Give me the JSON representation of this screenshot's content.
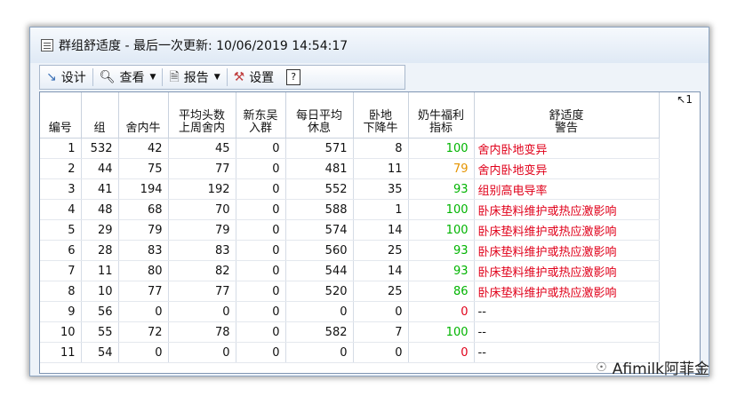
{
  "window": {
    "title": "群组舒适度 - 最后一次更新: 10/06/2019 14:54:17"
  },
  "toolbar": {
    "design": "设计",
    "view": "查看",
    "report": "报告",
    "settings": "设置",
    "help": "?"
  },
  "sort_mark": "↖1",
  "columns": [
    "编号",
    "组",
    "舍内牛",
    "平均头数\n上周舍内",
    "新东吴\n入群",
    "每日平均\n休息",
    "卧地\n下降牛",
    "奶牛福利\n指标",
    "舒适度\n警告"
  ],
  "rows": [
    {
      "no": "1",
      "group": "532",
      "in_pen": "42",
      "avg_last_week": "45",
      "new_in": "0",
      "daily_rest": "571",
      "lying_drop": "8",
      "welfare": "100",
      "welfare_color": "#00b400",
      "warning": "舍内卧地变异",
      "warning_color": "#e0001a"
    },
    {
      "no": "2",
      "group": "44",
      "in_pen": "75",
      "avg_last_week": "77",
      "new_in": "0",
      "daily_rest": "481",
      "lying_drop": "11",
      "welfare": "79",
      "welfare_color": "#e59400",
      "warning": "舍内卧地变异",
      "warning_color": "#e0001a"
    },
    {
      "no": "3",
      "group": "41",
      "in_pen": "194",
      "avg_last_week": "192",
      "new_in": "0",
      "daily_rest": "552",
      "lying_drop": "35",
      "welfare": "93",
      "welfare_color": "#00b400",
      "warning": "组别高电导率",
      "warning_color": "#e0001a"
    },
    {
      "no": "4",
      "group": "48",
      "in_pen": "68",
      "avg_last_week": "70",
      "new_in": "0",
      "daily_rest": "588",
      "lying_drop": "1",
      "welfare": "100",
      "welfare_color": "#00b400",
      "warning": "卧床垫料维护或热应激影响",
      "warning_color": "#e0001a"
    },
    {
      "no": "5",
      "group": "29",
      "in_pen": "79",
      "avg_last_week": "79",
      "new_in": "0",
      "daily_rest": "574",
      "lying_drop": "14",
      "welfare": "100",
      "welfare_color": "#00b400",
      "warning": "卧床垫料维护或热应激影响",
      "warning_color": "#e0001a"
    },
    {
      "no": "6",
      "group": "28",
      "in_pen": "83",
      "avg_last_week": "83",
      "new_in": "0",
      "daily_rest": "560",
      "lying_drop": "25",
      "welfare": "93",
      "welfare_color": "#00b400",
      "warning": "卧床垫料维护或热应激影响",
      "warning_color": "#e0001a"
    },
    {
      "no": "7",
      "group": "11",
      "in_pen": "80",
      "avg_last_week": "82",
      "new_in": "0",
      "daily_rest": "544",
      "lying_drop": "14",
      "welfare": "93",
      "welfare_color": "#00b400",
      "warning": "卧床垫料维护或热应激影响",
      "warning_color": "#e0001a"
    },
    {
      "no": "8",
      "group": "10",
      "in_pen": "77",
      "avg_last_week": "77",
      "new_in": "0",
      "daily_rest": "520",
      "lying_drop": "25",
      "welfare": "86",
      "welfare_color": "#00b400",
      "warning": "卧床垫料维护或热应激影响",
      "warning_color": "#e0001a"
    },
    {
      "no": "9",
      "group": "56",
      "in_pen": "0",
      "avg_last_week": "0",
      "new_in": "0",
      "daily_rest": "0",
      "lying_drop": "0",
      "welfare": "0",
      "welfare_color": "#e0001a",
      "warning": "--",
      "warning_color": "#111111"
    },
    {
      "no": "10",
      "group": "55",
      "in_pen": "72",
      "avg_last_week": "78",
      "new_in": "0",
      "daily_rest": "582",
      "lying_drop": "7",
      "welfare": "100",
      "welfare_color": "#00b400",
      "warning": "--",
      "warning_color": "#111111"
    },
    {
      "no": "11",
      "group": "54",
      "in_pen": "0",
      "avg_last_week": "0",
      "new_in": "0",
      "daily_rest": "0",
      "lying_drop": "0",
      "welfare": "0",
      "welfare_color": "#e0001a",
      "warning": "--",
      "warning_color": "#111111"
    }
  ],
  "watermark": "Afimilk阿菲金"
}
